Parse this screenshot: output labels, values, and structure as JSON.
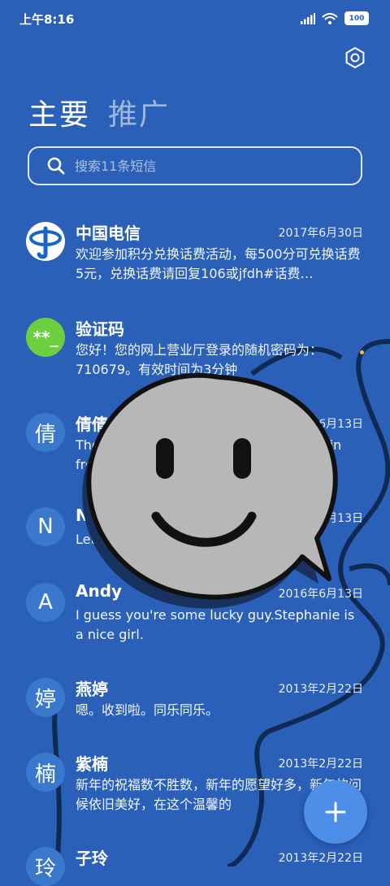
{
  "status_bar": {
    "time": "上午8:16",
    "battery": "100"
  },
  "tabs": [
    {
      "label": "主要",
      "active": true
    },
    {
      "label": "推广",
      "active": false
    }
  ],
  "search": {
    "placeholder": "搜索11条短信"
  },
  "conversations": [
    {
      "name": "中国电信",
      "date": "2017年6月30日",
      "preview": "欢迎参加积分兑换话费活动，每500分可兑换话费5元，兑换话费请回复106或jfdh#话费…",
      "avatar": "telecom-logo"
    },
    {
      "name": "验证码",
      "date": "",
      "preview": "您好！您的网上营业厅登录的随机密码为：710679。有效时间为3分钟",
      "avatar_text": "**_",
      "unread": true
    },
    {
      "name": "倩倩",
      "date": "2016年6月13日",
      "preview": "There was a table set out under a tree in front of the hous",
      "avatar_text": "倩"
    },
    {
      "name": "Nicole",
      "date": "2016年6月13日",
      "preview": "Let's eat out,shall we?",
      "avatar_text": "N"
    },
    {
      "name": "Andy",
      "date": "2016年6月13日",
      "preview": "I guess you're some lucky guy.Stephanie is a nice girl.",
      "avatar_text": "A"
    },
    {
      "name": "燕婷",
      "date": "2013年2月22日",
      "preview": "嗯。收到啦。同乐同乐。",
      "avatar_text": "婷"
    },
    {
      "name": "紫楠",
      "date": "2013年2月22日",
      "preview": "新年的祝福数不胜数，新年的愿望好多，新年的问候依旧美好，在这个温馨的",
      "avatar_text": "楠"
    },
    {
      "name": "子玲",
      "date": "2013年2月22日",
      "preview": "",
      "avatar_text": "玲"
    }
  ],
  "colors": {
    "background": "#2a60b8",
    "accent": "#4c8ee8",
    "unread_dot": "#f2c342",
    "avatar_green": "#6ccf3d"
  }
}
